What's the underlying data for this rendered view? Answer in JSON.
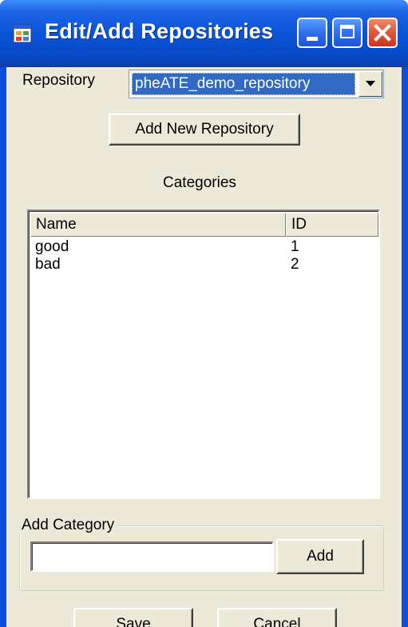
{
  "window": {
    "title": "Edit/Add Repositories",
    "icon": "app-window-icon",
    "controls": [
      "minimize-icon",
      "maximize-icon",
      "close-icon"
    ]
  },
  "repository": {
    "label": "Repository",
    "selected": "pheATE_demo_repository"
  },
  "add_repository_button": "Add New Repository",
  "categories": {
    "heading": "Categories",
    "columns": [
      "Name",
      "ID"
    ],
    "rows": [
      {
        "name": "good",
        "id": "1"
      },
      {
        "name": "bad",
        "id": "2"
      }
    ]
  },
  "add_category": {
    "group_label": "Add Category",
    "input_value": "",
    "add_label": "Add"
  },
  "footer": {
    "save_label": "Save",
    "cancel_label": "Cancel"
  },
  "colors": {
    "titlebar": "#0a54d9",
    "client": "#ece9d8",
    "selection": "#316ac5",
    "close_button": "#e0553a"
  }
}
